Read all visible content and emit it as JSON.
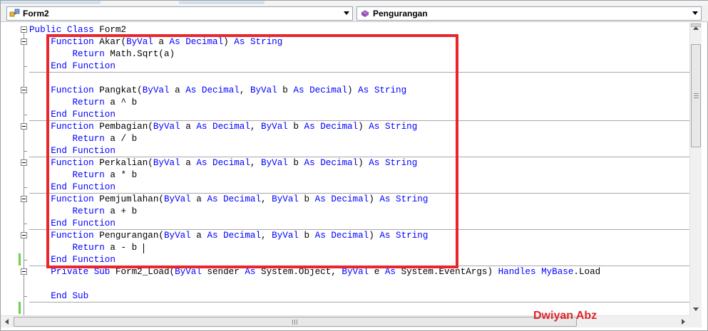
{
  "navigation": {
    "class_combo": {
      "label": "Form2",
      "icon": "class-icon"
    },
    "method_combo": {
      "label": "Pengurangan",
      "icon": "method-icon"
    }
  },
  "code": {
    "l01": [
      [
        "kw",
        "Public Class"
      ],
      [
        "t",
        " Form2"
      ]
    ],
    "l02": [
      [
        "t",
        "    "
      ],
      [
        "kw",
        "Function"
      ],
      [
        "t",
        " Akar("
      ],
      [
        "kw",
        "ByVal"
      ],
      [
        "t",
        " a "
      ],
      [
        "kw",
        "As"
      ],
      [
        "t",
        " "
      ],
      [
        "kw",
        "Decimal"
      ],
      [
        "t",
        ") "
      ],
      [
        "kw",
        "As"
      ],
      [
        "t",
        " "
      ],
      [
        "kw",
        "String"
      ]
    ],
    "l03": [
      [
        "t",
        "        "
      ],
      [
        "kw",
        "Return"
      ],
      [
        "t",
        " Math.Sqrt(a)"
      ]
    ],
    "l04": [
      [
        "t",
        "    "
      ],
      [
        "kw",
        "End Function"
      ]
    ],
    "l05": [
      [
        "t",
        ""
      ]
    ],
    "l06": [
      [
        "t",
        "    "
      ],
      [
        "kw",
        "Function"
      ],
      [
        "t",
        " Pangkat("
      ],
      [
        "kw",
        "ByVal"
      ],
      [
        "t",
        " a "
      ],
      [
        "kw",
        "As"
      ],
      [
        "t",
        " "
      ],
      [
        "kw",
        "Decimal"
      ],
      [
        "t",
        ", "
      ],
      [
        "kw",
        "ByVal"
      ],
      [
        "t",
        " b "
      ],
      [
        "kw",
        "As"
      ],
      [
        "t",
        " "
      ],
      [
        "kw",
        "Decimal"
      ],
      [
        "t",
        ") "
      ],
      [
        "kw",
        "As"
      ],
      [
        "t",
        " "
      ],
      [
        "kw",
        "String"
      ]
    ],
    "l07": [
      [
        "t",
        "        "
      ],
      [
        "kw",
        "Return"
      ],
      [
        "t",
        " a ^ b"
      ]
    ],
    "l08": [
      [
        "t",
        "    "
      ],
      [
        "kw",
        "End Function"
      ]
    ],
    "l09": [
      [
        "t",
        "    "
      ],
      [
        "kw",
        "Function"
      ],
      [
        "t",
        " Pembagian("
      ],
      [
        "kw",
        "ByVal"
      ],
      [
        "t",
        " a "
      ],
      [
        "kw",
        "As"
      ],
      [
        "t",
        " "
      ],
      [
        "kw",
        "Decimal"
      ],
      [
        "t",
        ", "
      ],
      [
        "kw",
        "ByVal"
      ],
      [
        "t",
        " b "
      ],
      [
        "kw",
        "As"
      ],
      [
        "t",
        " "
      ],
      [
        "kw",
        "Decimal"
      ],
      [
        "t",
        ") "
      ],
      [
        "kw",
        "As"
      ],
      [
        "t",
        " "
      ],
      [
        "kw",
        "String"
      ]
    ],
    "l10": [
      [
        "t",
        "        "
      ],
      [
        "kw",
        "Return"
      ],
      [
        "t",
        " a / b"
      ]
    ],
    "l11": [
      [
        "t",
        "    "
      ],
      [
        "kw",
        "End Function"
      ]
    ],
    "l12": [
      [
        "t",
        "    "
      ],
      [
        "kw",
        "Function"
      ],
      [
        "t",
        " Perkalian("
      ],
      [
        "kw",
        "ByVal"
      ],
      [
        "t",
        " a "
      ],
      [
        "kw",
        "As"
      ],
      [
        "t",
        " "
      ],
      [
        "kw",
        "Decimal"
      ],
      [
        "t",
        ", "
      ],
      [
        "kw",
        "ByVal"
      ],
      [
        "t",
        " b "
      ],
      [
        "kw",
        "As"
      ],
      [
        "t",
        " "
      ],
      [
        "kw",
        "Decimal"
      ],
      [
        "t",
        ") "
      ],
      [
        "kw",
        "As"
      ],
      [
        "t",
        " "
      ],
      [
        "kw",
        "String"
      ]
    ],
    "l13": [
      [
        "t",
        "        "
      ],
      [
        "kw",
        "Return"
      ],
      [
        "t",
        " a * b"
      ]
    ],
    "l14": [
      [
        "t",
        "    "
      ],
      [
        "kw",
        "End Function"
      ]
    ],
    "l15": [
      [
        "t",
        "    "
      ],
      [
        "kw",
        "Function"
      ],
      [
        "t",
        " Pemjumlahan("
      ],
      [
        "kw",
        "ByVal"
      ],
      [
        "t",
        " a "
      ],
      [
        "kw",
        "As"
      ],
      [
        "t",
        " "
      ],
      [
        "kw",
        "Decimal"
      ],
      [
        "t",
        ", "
      ],
      [
        "kw",
        "ByVal"
      ],
      [
        "t",
        " b "
      ],
      [
        "kw",
        "As"
      ],
      [
        "t",
        " "
      ],
      [
        "kw",
        "Decimal"
      ],
      [
        "t",
        ") "
      ],
      [
        "kw",
        "As"
      ],
      [
        "t",
        " "
      ],
      [
        "kw",
        "String"
      ]
    ],
    "l16": [
      [
        "t",
        "        "
      ],
      [
        "kw",
        "Return"
      ],
      [
        "t",
        " a + b"
      ]
    ],
    "l17": [
      [
        "t",
        "    "
      ],
      [
        "kw",
        "End Function"
      ]
    ],
    "l18": [
      [
        "t",
        "    "
      ],
      [
        "kw",
        "Function"
      ],
      [
        "t",
        " Pengurangan("
      ],
      [
        "kw",
        "ByVal"
      ],
      [
        "t",
        " a "
      ],
      [
        "kw",
        "As"
      ],
      [
        "t",
        " "
      ],
      [
        "kw",
        "Decimal"
      ],
      [
        "t",
        ", "
      ],
      [
        "kw",
        "ByVal"
      ],
      [
        "t",
        " b "
      ],
      [
        "kw",
        "As"
      ],
      [
        "t",
        " "
      ],
      [
        "kw",
        "Decimal"
      ],
      [
        "t",
        ") "
      ],
      [
        "kw",
        "As"
      ],
      [
        "t",
        " "
      ],
      [
        "kw",
        "String"
      ]
    ],
    "l19": [
      [
        "t",
        "        "
      ],
      [
        "kw",
        "Return"
      ],
      [
        "t",
        " a - b"
      ]
    ],
    "l20": [
      [
        "t",
        "    "
      ],
      [
        "kw",
        "End Function"
      ]
    ],
    "l21": [
      [
        "t",
        "    "
      ],
      [
        "kw",
        "Private Sub"
      ],
      [
        "t",
        " Form2_Load("
      ],
      [
        "kw",
        "ByVal"
      ],
      [
        "t",
        " sender "
      ],
      [
        "kw",
        "As"
      ],
      [
        "t",
        " System.Object, "
      ],
      [
        "kw",
        "ByVal"
      ],
      [
        "t",
        " e "
      ],
      [
        "kw",
        "As"
      ],
      [
        "t",
        " System.EventArgs) "
      ],
      [
        "kw",
        "Handles"
      ],
      [
        "t",
        " "
      ],
      [
        "kw",
        "MyBase"
      ],
      [
        "t",
        ".Load"
      ]
    ],
    "l22": [
      [
        "t",
        ""
      ]
    ],
    "l23": [
      [
        "t",
        "    "
      ],
      [
        "kw",
        "End Sub"
      ]
    ],
    "l24": [
      [
        "t",
        ""
      ]
    ]
  },
  "watermark": "Dwiyan Abz",
  "colors": {
    "keyword": "#0000ff",
    "highlight_border": "#e8262b",
    "watermark": "#e0232a",
    "changed_marker": "#6fcf4a"
  }
}
